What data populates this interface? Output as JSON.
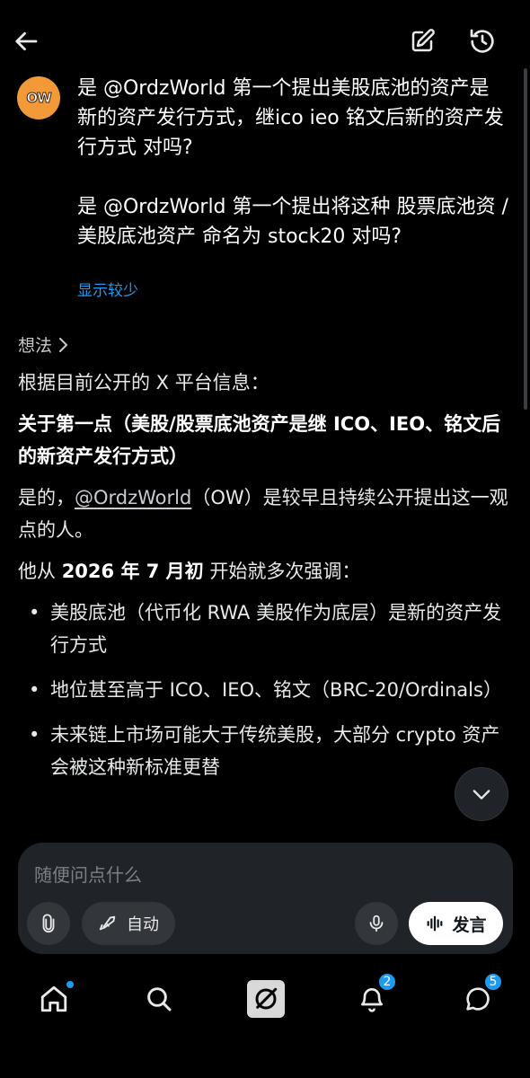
{
  "colors": {
    "background": "#000000",
    "accent": "#1d9bf0",
    "avatar": "#f29a38"
  },
  "topbar": {
    "back_icon": "arrow-left-icon",
    "edit_icon": "edit-icon",
    "history_icon": "history-icon"
  },
  "question": {
    "avatar_text": "OW",
    "paragraphs": [
      "是 @OrdzWorld 第一个提出美股底池的资产是新的资产发行方式，继ico ieo 铭文后新的资产发行方式 对吗?",
      "是 @OrdzWorld 第一个提出将这种 股票底池资 / 美股底池资产 命名为 stock20 对吗?"
    ],
    "show_less": "显示较少"
  },
  "thoughts_label": "想法",
  "answer": {
    "intro": "根据目前公开的 X 平台信息：",
    "point1_heading": "关于第一点（美股/股票底池资产是继 ICO、IEO、铭文后的新资产发行方式）",
    "reply_prefix": "是的，",
    "mention": "@OrdzWorld",
    "reply_suffix": "（OW）是较早且持续公开提出这一观点的人。",
    "since_prefix": "他从 ",
    "since_date": "2026 年 7 月初",
    "since_suffix": " 开始就多次强调：",
    "bullets": [
      "美股底池（代币化 RWA 美股作为底层）是新的资产发行方式",
      "地位甚至高于 ICO、IEO、铭文（BRC-20/Ordinals）",
      "未来链上市场可能大于传统美股，大部分 crypto 资产会被这种新标准更替"
    ]
  },
  "composer": {
    "placeholder": "随便问点什么",
    "auto_label": "自动",
    "speak_label": "发言"
  },
  "nav": {
    "notifications_badge": "2",
    "messages_badge": "5"
  }
}
